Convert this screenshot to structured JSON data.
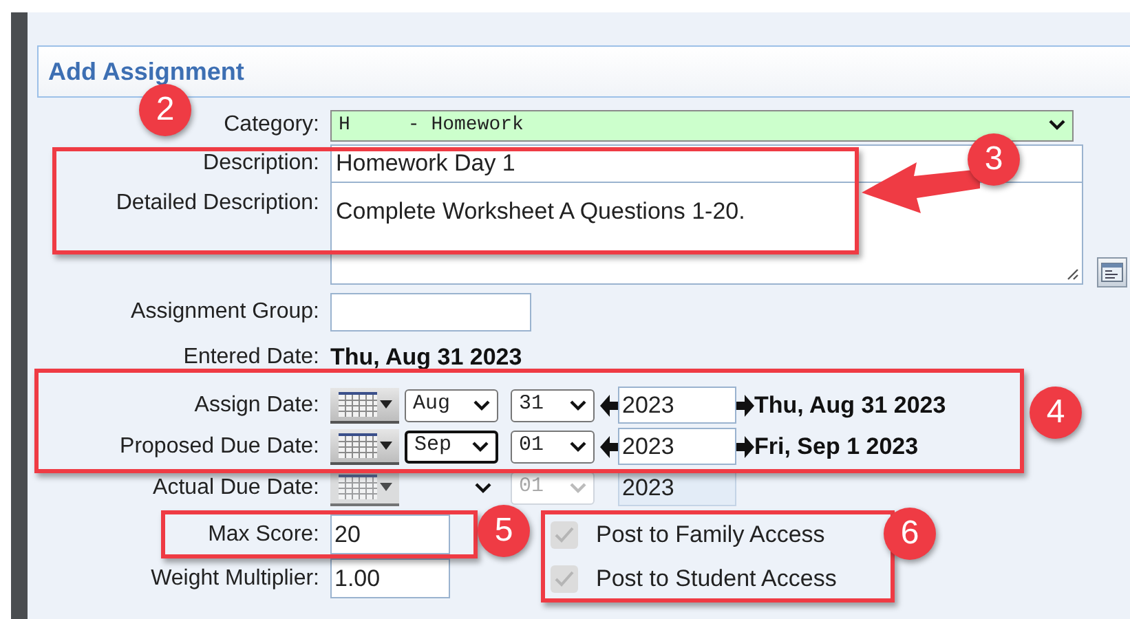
{
  "window": {
    "title": "Add Assignment"
  },
  "form": {
    "category": {
      "label": "Category:",
      "value": "H     - Homework"
    },
    "description": {
      "label": "Description:",
      "value": "Homework Day 1"
    },
    "detailed_description": {
      "label": "Detailed Description:",
      "value": "Complete Worksheet A Questions 1-20."
    },
    "assignment_group": {
      "label": "Assignment Group:"
    },
    "entered_date": {
      "label": "Entered Date:",
      "value": "Thu, Aug 31 2023"
    },
    "dates": [
      {
        "label": "Assign Date:",
        "month": "Aug",
        "day": "31",
        "year": "2023",
        "display": "Thu, Aug 31 2023",
        "focused": false,
        "disabled": false
      },
      {
        "label": "Proposed Due Date:",
        "month": "Sep",
        "day": "01",
        "year": "2023",
        "display": "Fri, Sep 1 2023",
        "focused": true,
        "disabled": false
      },
      {
        "label": "Actual Due Date:",
        "day": "01",
        "year": "2023",
        "focused": false,
        "disabled": true
      }
    ],
    "max_score": {
      "label": "Max Score:",
      "value": "20"
    },
    "weight_multiplier": {
      "label": "Weight Multiplier:",
      "value": "1.00"
    },
    "options": [
      {
        "label": "Post to Family Access",
        "checked": true,
        "disabled": true
      },
      {
        "label": "Post to Student Access",
        "checked": true,
        "disabled": true
      }
    ]
  },
  "annotations": [
    {
      "number": "2"
    },
    {
      "number": "3"
    },
    {
      "number": "4"
    },
    {
      "number": "5"
    },
    {
      "number": "6"
    }
  ]
}
